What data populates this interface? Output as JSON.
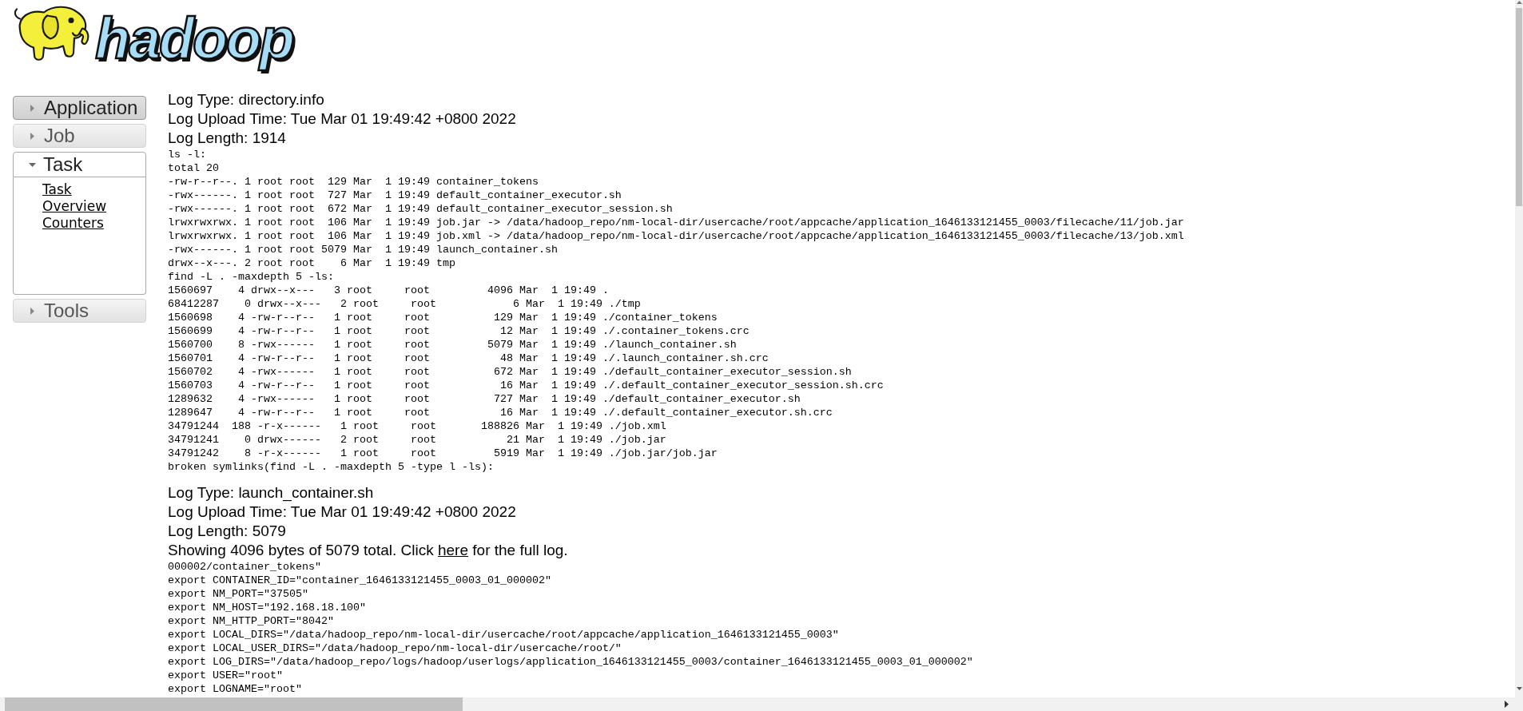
{
  "logo": {
    "text": "hadoop"
  },
  "sidebar": {
    "items": [
      {
        "label": "Application",
        "expanded": false,
        "hovered": true
      },
      {
        "label": "Job",
        "expanded": false,
        "hovered": false
      },
      {
        "label": "Task",
        "expanded": true,
        "hovered": false,
        "links": [
          "Task Overview",
          "Counters"
        ]
      },
      {
        "label": "Tools",
        "expanded": false,
        "hovered": false
      }
    ]
  },
  "logs": [
    {
      "header_lines": [
        "Log Type: directory.info",
        "Log Upload Time: Tue Mar 01 19:49:42 +0800 2022",
        "Log Length: 1914"
      ],
      "lines": [
        "ls -l:",
        "total 20",
        "-rw-r--r--. 1 root root  129 Mar  1 19:49 container_tokens",
        "-rwx------. 1 root root  727 Mar  1 19:49 default_container_executor.sh",
        "-rwx------. 1 root root  672 Mar  1 19:49 default_container_executor_session.sh",
        "lrwxrwxrwx. 1 root root  106 Mar  1 19:49 job.jar -> /data/hadoop_repo/nm-local-dir/usercache/root/appcache/application_1646133121455_0003/filecache/11/job.jar",
        "lrwxrwxrwx. 1 root root  106 Mar  1 19:49 job.xml -> /data/hadoop_repo/nm-local-dir/usercache/root/appcache/application_1646133121455_0003/filecache/13/job.xml",
        "-rwx------. 1 root root 5079 Mar  1 19:49 launch_container.sh",
        "drwx--x---. 2 root root    6 Mar  1 19:49 tmp",
        "find -L . -maxdepth 5 -ls:",
        "1560697    4 drwx--x---   3 root     root         4096 Mar  1 19:49 .",
        "68412287    0 drwx--x---   2 root     root            6 Mar  1 19:49 ./tmp",
        "1560698    4 -rw-r--r--   1 root     root          129 Mar  1 19:49 ./container_tokens",
        "1560699    4 -rw-r--r--   1 root     root           12 Mar  1 19:49 ./.container_tokens.crc",
        "1560700    8 -rwx------   1 root     root         5079 Mar  1 19:49 ./launch_container.sh",
        "1560701    4 -rw-r--r--   1 root     root           48 Mar  1 19:49 ./.launch_container.sh.crc",
        "1560702    4 -rwx------   1 root     root          672 Mar  1 19:49 ./default_container_executor_session.sh",
        "1560703    4 -rw-r--r--   1 root     root           16 Mar  1 19:49 ./.default_container_executor_session.sh.crc",
        "1289632    4 -rwx------   1 root     root          727 Mar  1 19:49 ./default_container_executor.sh",
        "1289647    4 -rw-r--r--   1 root     root           16 Mar  1 19:49 ./.default_container_executor.sh.crc",
        "34791244  188 -r-x------   1 root     root       188826 Mar  1 19:49 ./job.xml",
        "34791241    0 drwx------   2 root     root           21 Mar  1 19:49 ./job.jar",
        "34791242    8 -r-x------   1 root     root         5919 Mar  1 19:49 ./job.jar/job.jar",
        "broken symlinks(find -L . -maxdepth 5 -type l -ls):"
      ]
    },
    {
      "header_lines": [
        "Log Type: launch_container.sh",
        "Log Upload Time: Tue Mar 01 19:49:42 +0800 2022",
        "Log Length: 5079"
      ],
      "notice": {
        "text_before": "Showing 4096 bytes of 5079 total. Click ",
        "link": "here",
        "text_after": " for the full log."
      },
      "lines": [
        "000002/container_tokens\"",
        "export CONTAINER_ID=\"container_1646133121455_0003_01_000002\"",
        "export NM_PORT=\"37505\"",
        "export NM_HOST=\"192.168.18.100\"",
        "export NM_HTTP_PORT=\"8042\"",
        "export LOCAL_DIRS=\"/data/hadoop_repo/nm-local-dir/usercache/root/appcache/application_1646133121455_0003\"",
        "export LOCAL_USER_DIRS=\"/data/hadoop_repo/nm-local-dir/usercache/root/\"",
        "export LOG_DIRS=\"/data/hadoop_repo/logs/hadoop/userlogs/application_1646133121455_0003/container_1646133121455_0003_01_000002\"",
        "export USER=\"root\"",
        "export LOGNAME=\"root\""
      ]
    }
  ]
}
